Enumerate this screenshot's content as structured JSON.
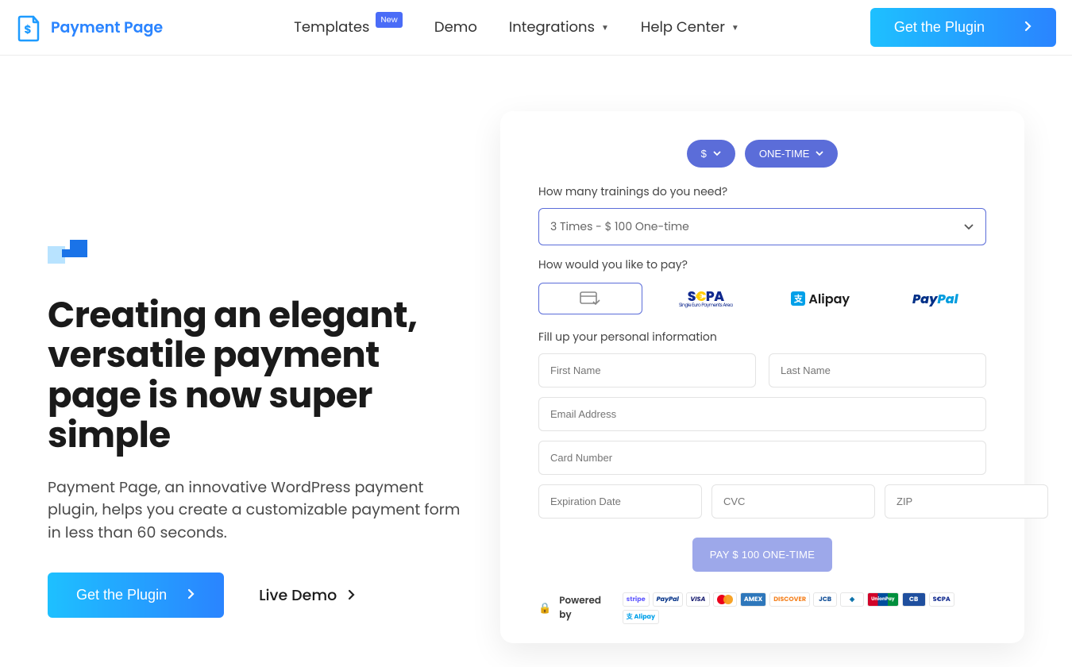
{
  "brand": {
    "name": "Payment Page"
  },
  "nav": {
    "templates": "Templates",
    "templates_badge": "New",
    "demo": "Demo",
    "integrations": "Integrations",
    "help": "Help Center"
  },
  "cta_header": "Get the Plugin",
  "hero": {
    "headline": "Creating an elegant, versatile payment page is now super simple",
    "sub": "Payment Page, an innovative WordPress payment plugin, helps you create a customizable payment form in less than 60 seconds.",
    "btn_primary": "Get the Plugin",
    "link_demo": "Live Demo"
  },
  "form": {
    "currency": "$",
    "frequency": "ONE-TIME",
    "question": "How many trainings do you need?",
    "select_value": "3 Times - $ 100 One-time",
    "pay_question": "How would you like to pay?",
    "method_card": "card",
    "method_sepa": "S€PA",
    "method_sepa_sub": "Single Euro Payments Area",
    "method_alipay": "Alipay",
    "method_paypal_1": "Pay",
    "method_paypal_2": "Pal",
    "personal_info": "Fill up your personal information",
    "first_name_ph": "First Name",
    "last_name_ph": "Last Name",
    "email_ph": "Email Address",
    "card_ph": "Card Number",
    "exp_ph": "Expiration Date",
    "cvc_ph": "CVC",
    "zip_ph": "ZIP",
    "pay_btn": "PAY $ 100 ONE-TIME",
    "powered": "Powered by",
    "brands": [
      "stripe",
      "PayPal",
      "VISA",
      "mc",
      "AMEX",
      "DISCOVER",
      "JCB",
      "◈",
      "UnionPay",
      "CB",
      "S€PA",
      "支 Alipay"
    ]
  }
}
